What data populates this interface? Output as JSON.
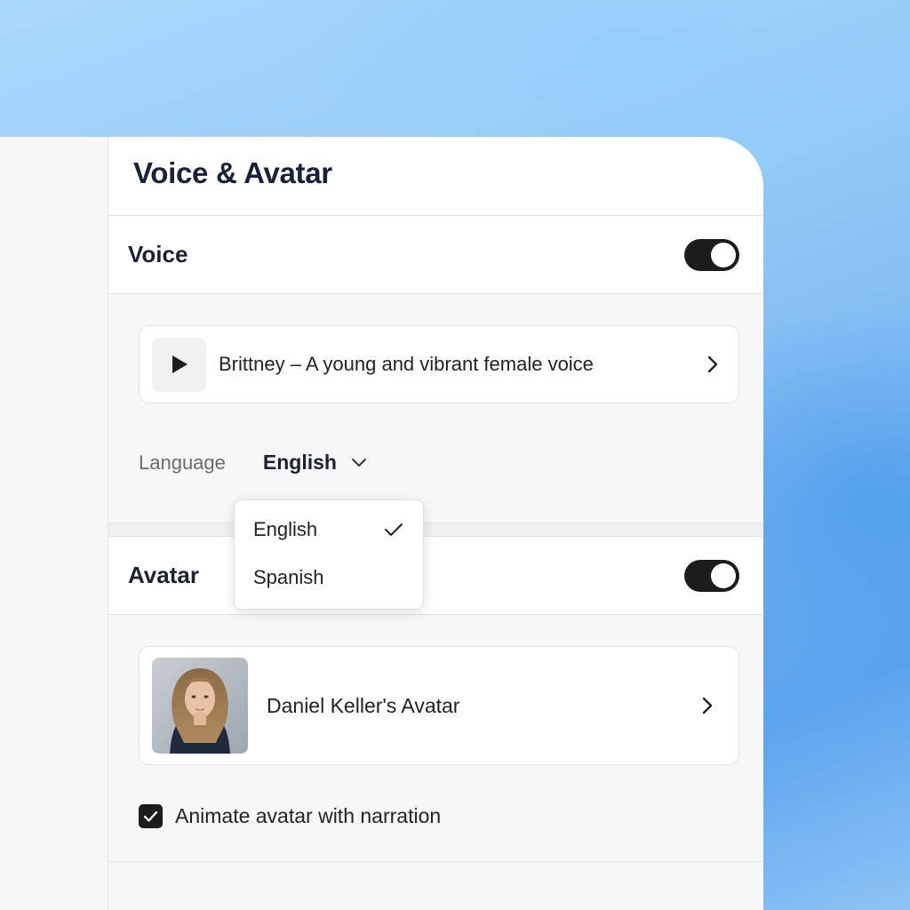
{
  "panel": {
    "title": "Voice & Avatar"
  },
  "voice": {
    "section_title": "Voice",
    "enabled": true,
    "selected_voice": "Brittney – A young and vibrant female voice",
    "language_label": "Language",
    "language_value": "English"
  },
  "language_dropdown": {
    "options": [
      {
        "label": "English",
        "selected": true
      },
      {
        "label": "Spanish",
        "selected": false
      }
    ]
  },
  "avatar": {
    "section_title": "Avatar",
    "enabled": true,
    "selected_avatar": "Daniel Keller's Avatar",
    "animate_label": "Animate avatar with narration",
    "animate_checked": true
  },
  "icons": {
    "play": "play-icon",
    "chevron_right": "chevron-right-icon",
    "chevron_down": "chevron-down-icon",
    "check": "check-icon"
  },
  "colors": {
    "toggle_on": "#1c1c1c",
    "title_text": "#16213a",
    "background_blue": "#7ab8f1"
  }
}
